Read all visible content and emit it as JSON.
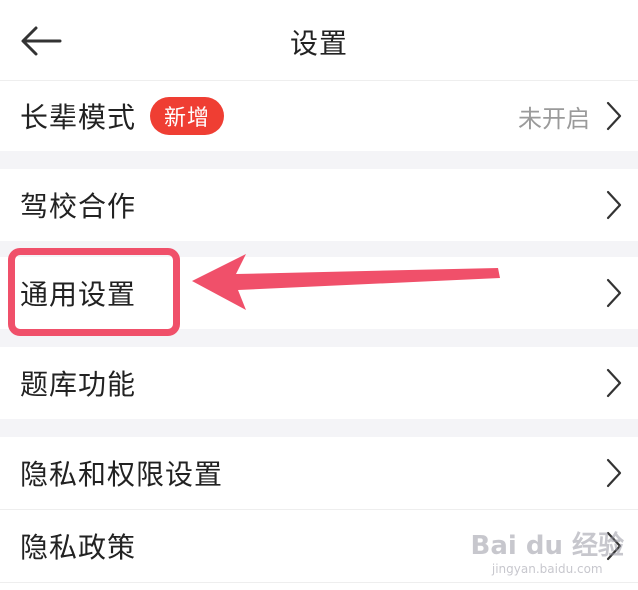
{
  "header": {
    "title": "设置"
  },
  "rows": {
    "elder_mode": {
      "label": "长辈模式",
      "badge": "新增",
      "status": "未开启"
    },
    "driving_school": {
      "label": "驾校合作"
    },
    "general_settings": {
      "label": "通用设置"
    },
    "question_bank": {
      "label": "题库功能"
    },
    "privacy_permissions": {
      "label": "隐私和权限设置"
    },
    "privacy_policy": {
      "label": "隐私政策"
    }
  },
  "watermark": {
    "text": "Bai du 经验",
    "sub": "jingyan.baidu.com"
  },
  "colors": {
    "badge": "#ef3e33",
    "highlight": "#f0506a",
    "separator": "#f4f4f7"
  },
  "icons": [
    "back-arrow-icon",
    "chevron-right-icon",
    "annotation-arrow-icon"
  ]
}
